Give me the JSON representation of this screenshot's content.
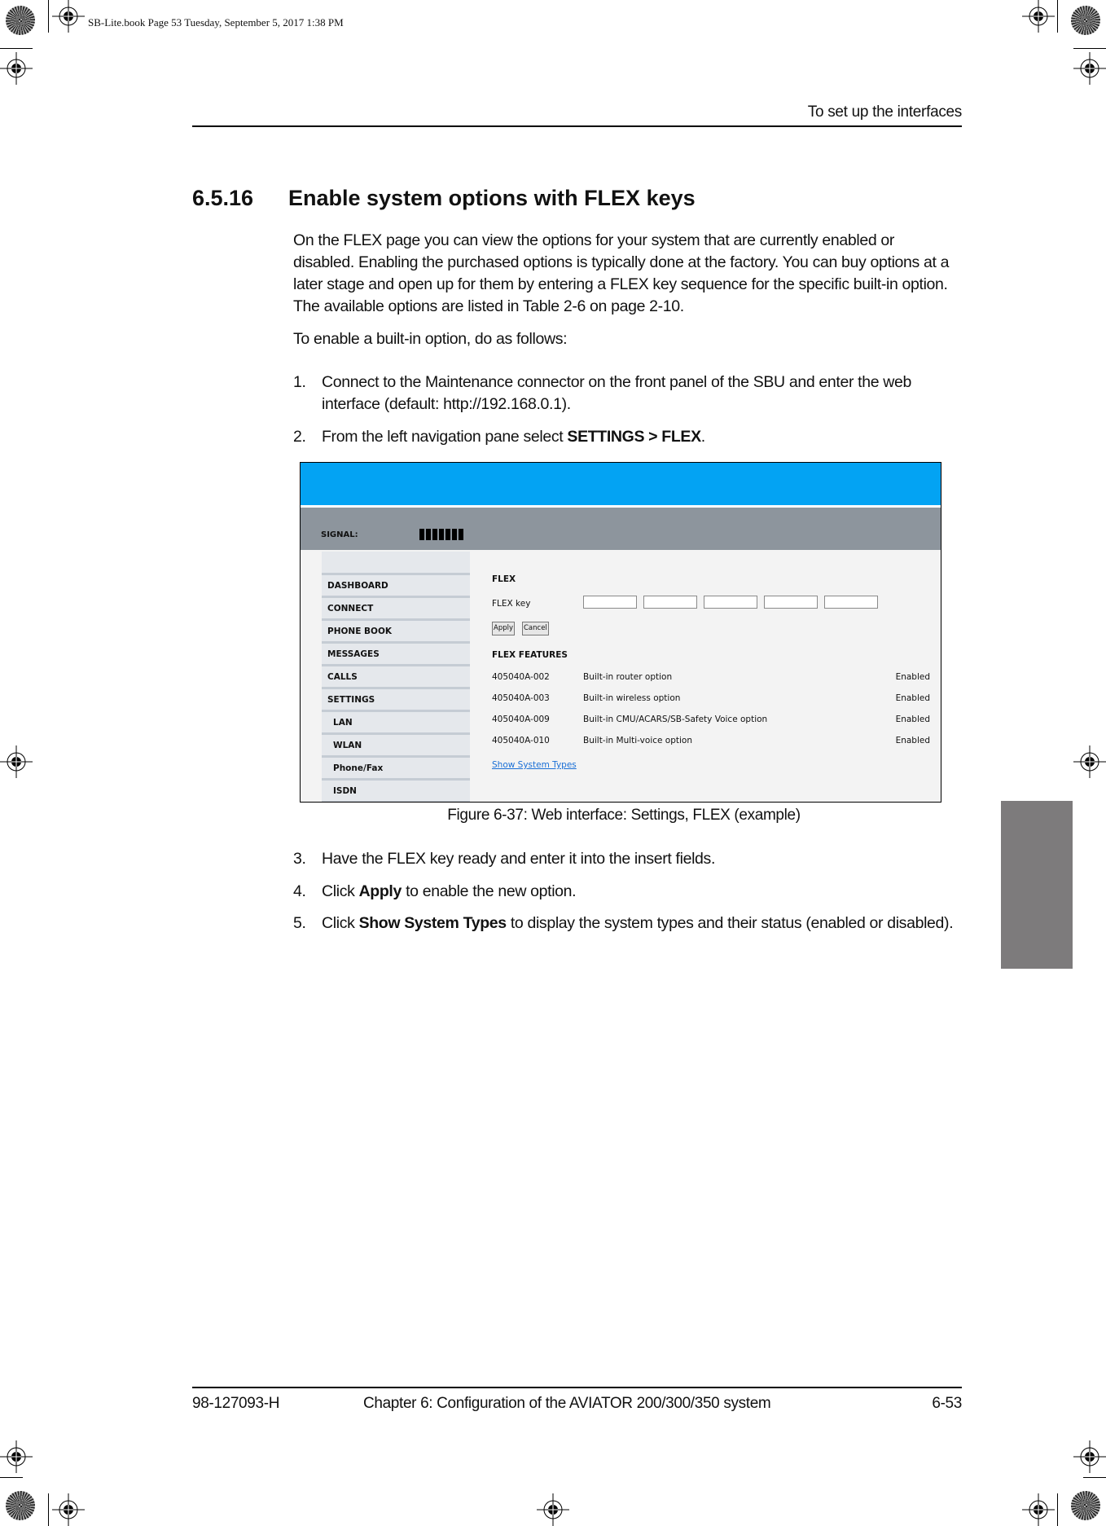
{
  "print_info": "SB-Lite.book  Page 53  Tuesday, September 5, 2017  1:38 PM",
  "header": {
    "running_title": "To set up the interfaces"
  },
  "section": {
    "number": "6.5.16",
    "title": "Enable system options with FLEX keys"
  },
  "intro": {
    "paragraph": "On the FLEX page you can view the options for your system that are currently enabled or disabled. Enabling the purchased options is typically done at the factory. You can buy options at a later stage and open up for them by entering a FLEX key sequence for the specific built-in option. The available options are listed in Table 2-6 on page 2-10.",
    "lead_in": "To enable a built-in option, do as follows:"
  },
  "steps": [
    {
      "n": "1.",
      "pre": "Connect to the Maintenance connector on the front panel of the SBU and enter the web interface (default: http://192.168.0.1).",
      "bold": "",
      "post": ""
    },
    {
      "n": "2.",
      "pre": "From the left navigation pane select ",
      "bold": "SETTINGS > FLEX",
      "post": "."
    },
    {
      "n": "3.",
      "pre": "Have the FLEX key ready and enter it into the insert fields.",
      "bold": "",
      "post": ""
    },
    {
      "n": "4.",
      "pre": "Click ",
      "bold": "Apply",
      "post": " to enable the new option."
    },
    {
      "n": "5.",
      "pre": "Click ",
      "bold": "Show System Types",
      "post": " to display the system types and their status (enabled or disabled)."
    }
  ],
  "figure": {
    "caption": "Figure 6-37: Web interface: Settings, FLEX (example)",
    "colors": {
      "top_bar": "#03a3f3",
      "signal_bar": "#8d959d",
      "sidebar": "#e5e8ec",
      "link": "#1a6fd6"
    },
    "signal": {
      "label": "SIGNAL:",
      "bars": 7
    },
    "sidebar": [
      {
        "label": "DASHBOARD",
        "sub": false
      },
      {
        "label": "CONNECT",
        "sub": false
      },
      {
        "label": "PHONE BOOK",
        "sub": false
      },
      {
        "label": "MESSAGES",
        "sub": false
      },
      {
        "label": "CALLS",
        "sub": false
      },
      {
        "label": "SETTINGS",
        "sub": false
      },
      {
        "label": "LAN",
        "sub": true
      },
      {
        "label": "WLAN",
        "sub": true
      },
      {
        "label": "Phone/Fax",
        "sub": true
      },
      {
        "label": "ISDN",
        "sub": true
      }
    ],
    "flex": {
      "title": "FLEX",
      "key_label": "FLEX key",
      "key_fields": [
        "",
        "",
        "",
        "",
        ""
      ],
      "apply_label": "Apply",
      "cancel_label": "Cancel",
      "features_title": "FLEX FEATURES",
      "features": [
        {
          "code": "405040A-002",
          "desc": "Built-in router option",
          "status": "Enabled"
        },
        {
          "code": "405040A-003",
          "desc": "Built-in wireless option",
          "status": "Enabled"
        },
        {
          "code": "405040A-009",
          "desc": "Built-in CMU/ACARS/SB-Safety Voice option",
          "status": "Enabled"
        },
        {
          "code": "405040A-010",
          "desc": "Built-in Multi-voice option",
          "status": "Enabled"
        }
      ],
      "show_link": "Show System Types"
    }
  },
  "footer": {
    "doc_number": "98-127093-H",
    "chapter": "Chapter 6:  Configuration of the AVIATOR 200/300/350 system",
    "page": "6-53"
  }
}
